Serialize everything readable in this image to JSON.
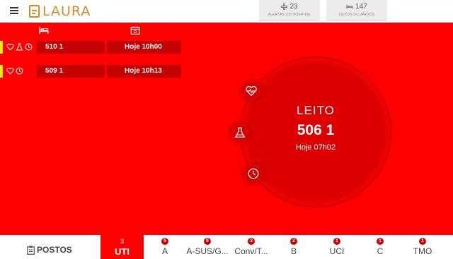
{
  "app": {
    "logo_text": "LAURA"
  },
  "header": {
    "alerts": {
      "value": "23",
      "label": "ALERTAS DO HOSPITAL",
      "icon": "hospital-cross-icon"
    },
    "beds": {
      "value": "147",
      "label": "LEITOS OCUPADOS",
      "icon": "bed-icon"
    }
  },
  "list": {
    "header_icons": [
      "bed-icon",
      "calendar-icon"
    ],
    "rows": [
      {
        "bed": "510 1",
        "time": "Hoje 10h00",
        "icons": [
          "heart-icon",
          "flask-icon",
          "clock-icon"
        ]
      },
      {
        "bed": "509 1",
        "time": "Hoje 10h13",
        "icons": [
          "heart-icon",
          "clock-icon"
        ]
      }
    ]
  },
  "detail": {
    "title": "LEITO",
    "bed": "506 1",
    "time": "Hoje 07h02",
    "orbit_icons": [
      "heart-pulse-icon",
      "flask-icon",
      "clock-icon"
    ]
  },
  "bottom": {
    "postos_label": "POSTOS",
    "tabs": [
      {
        "count": "3",
        "label": "UTI",
        "active": true
      },
      {
        "count": "5",
        "label": "A"
      },
      {
        "count": "5",
        "label": "A-SUS/G..."
      },
      {
        "count": "3",
        "label": "Conv/T..."
      },
      {
        "count": "2",
        "label": "B"
      },
      {
        "count": "1",
        "label": "UCI"
      },
      {
        "count": "1",
        "label": "C"
      },
      {
        "count": "1",
        "label": "TMO"
      }
    ]
  },
  "colors": {
    "background": "#ff0000",
    "accent": "#d58a2a",
    "row": "#c40000",
    "marker": "#f6e51c"
  }
}
